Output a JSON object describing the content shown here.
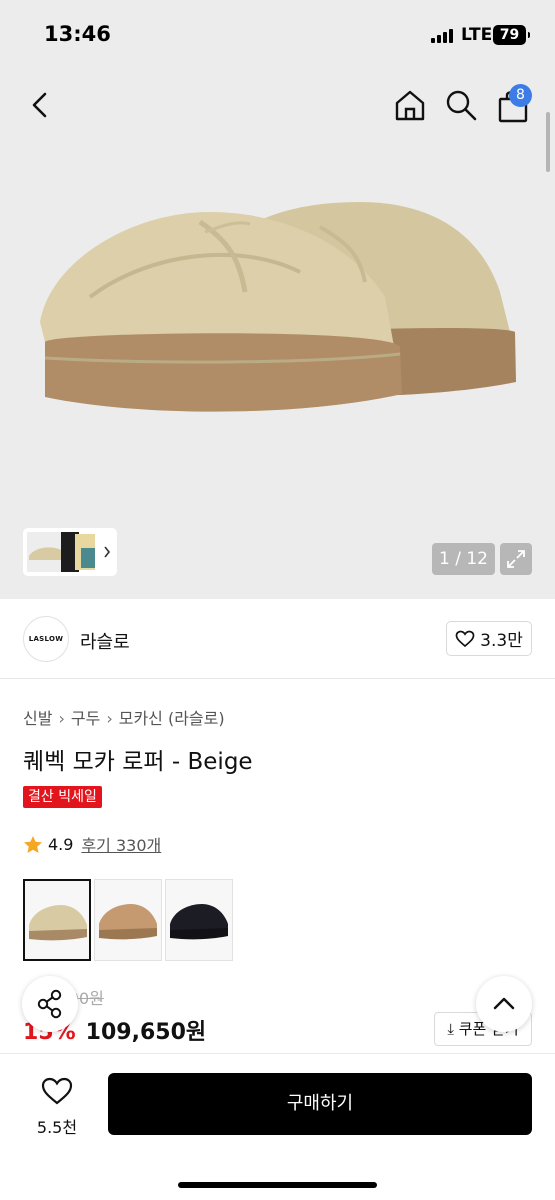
{
  "status_bar": {
    "time": "13:46",
    "network": "LTE",
    "battery": "79"
  },
  "header": {
    "cart_count": "8"
  },
  "gallery": {
    "counter": "1 / 12"
  },
  "brand": {
    "logo_text": "LASLOW",
    "name": "라슬로",
    "likes": "3.3만"
  },
  "breadcrumb": [
    "신발",
    "구두",
    "모카신 (라슬로)"
  ],
  "product": {
    "title": "퀘벡 모카 로퍼 - Beige",
    "badge": "결산 빅세일",
    "rating": "4.9",
    "reviews": "후기 330개"
  },
  "variants": [
    {
      "name": "beige",
      "color": "#d8cba4",
      "sole": "#a98a66"
    },
    {
      "name": "brown",
      "color": "#c59a70",
      "sole": "#9c7852"
    },
    {
      "name": "black",
      "color": "#1c1d24",
      "sole": "#111116"
    }
  ],
  "price": {
    "original": "129,000원",
    "discount": "15%",
    "current": "109,650원",
    "coupon": "⤓ 쿠폰 받기"
  },
  "bottom_bar": {
    "wish_count": "5.5천",
    "buy_label": "구매하기"
  },
  "colors": {
    "accent": "#e3151c",
    "badge_blue": "#3d7ce6",
    "buy_button": "#000000"
  }
}
